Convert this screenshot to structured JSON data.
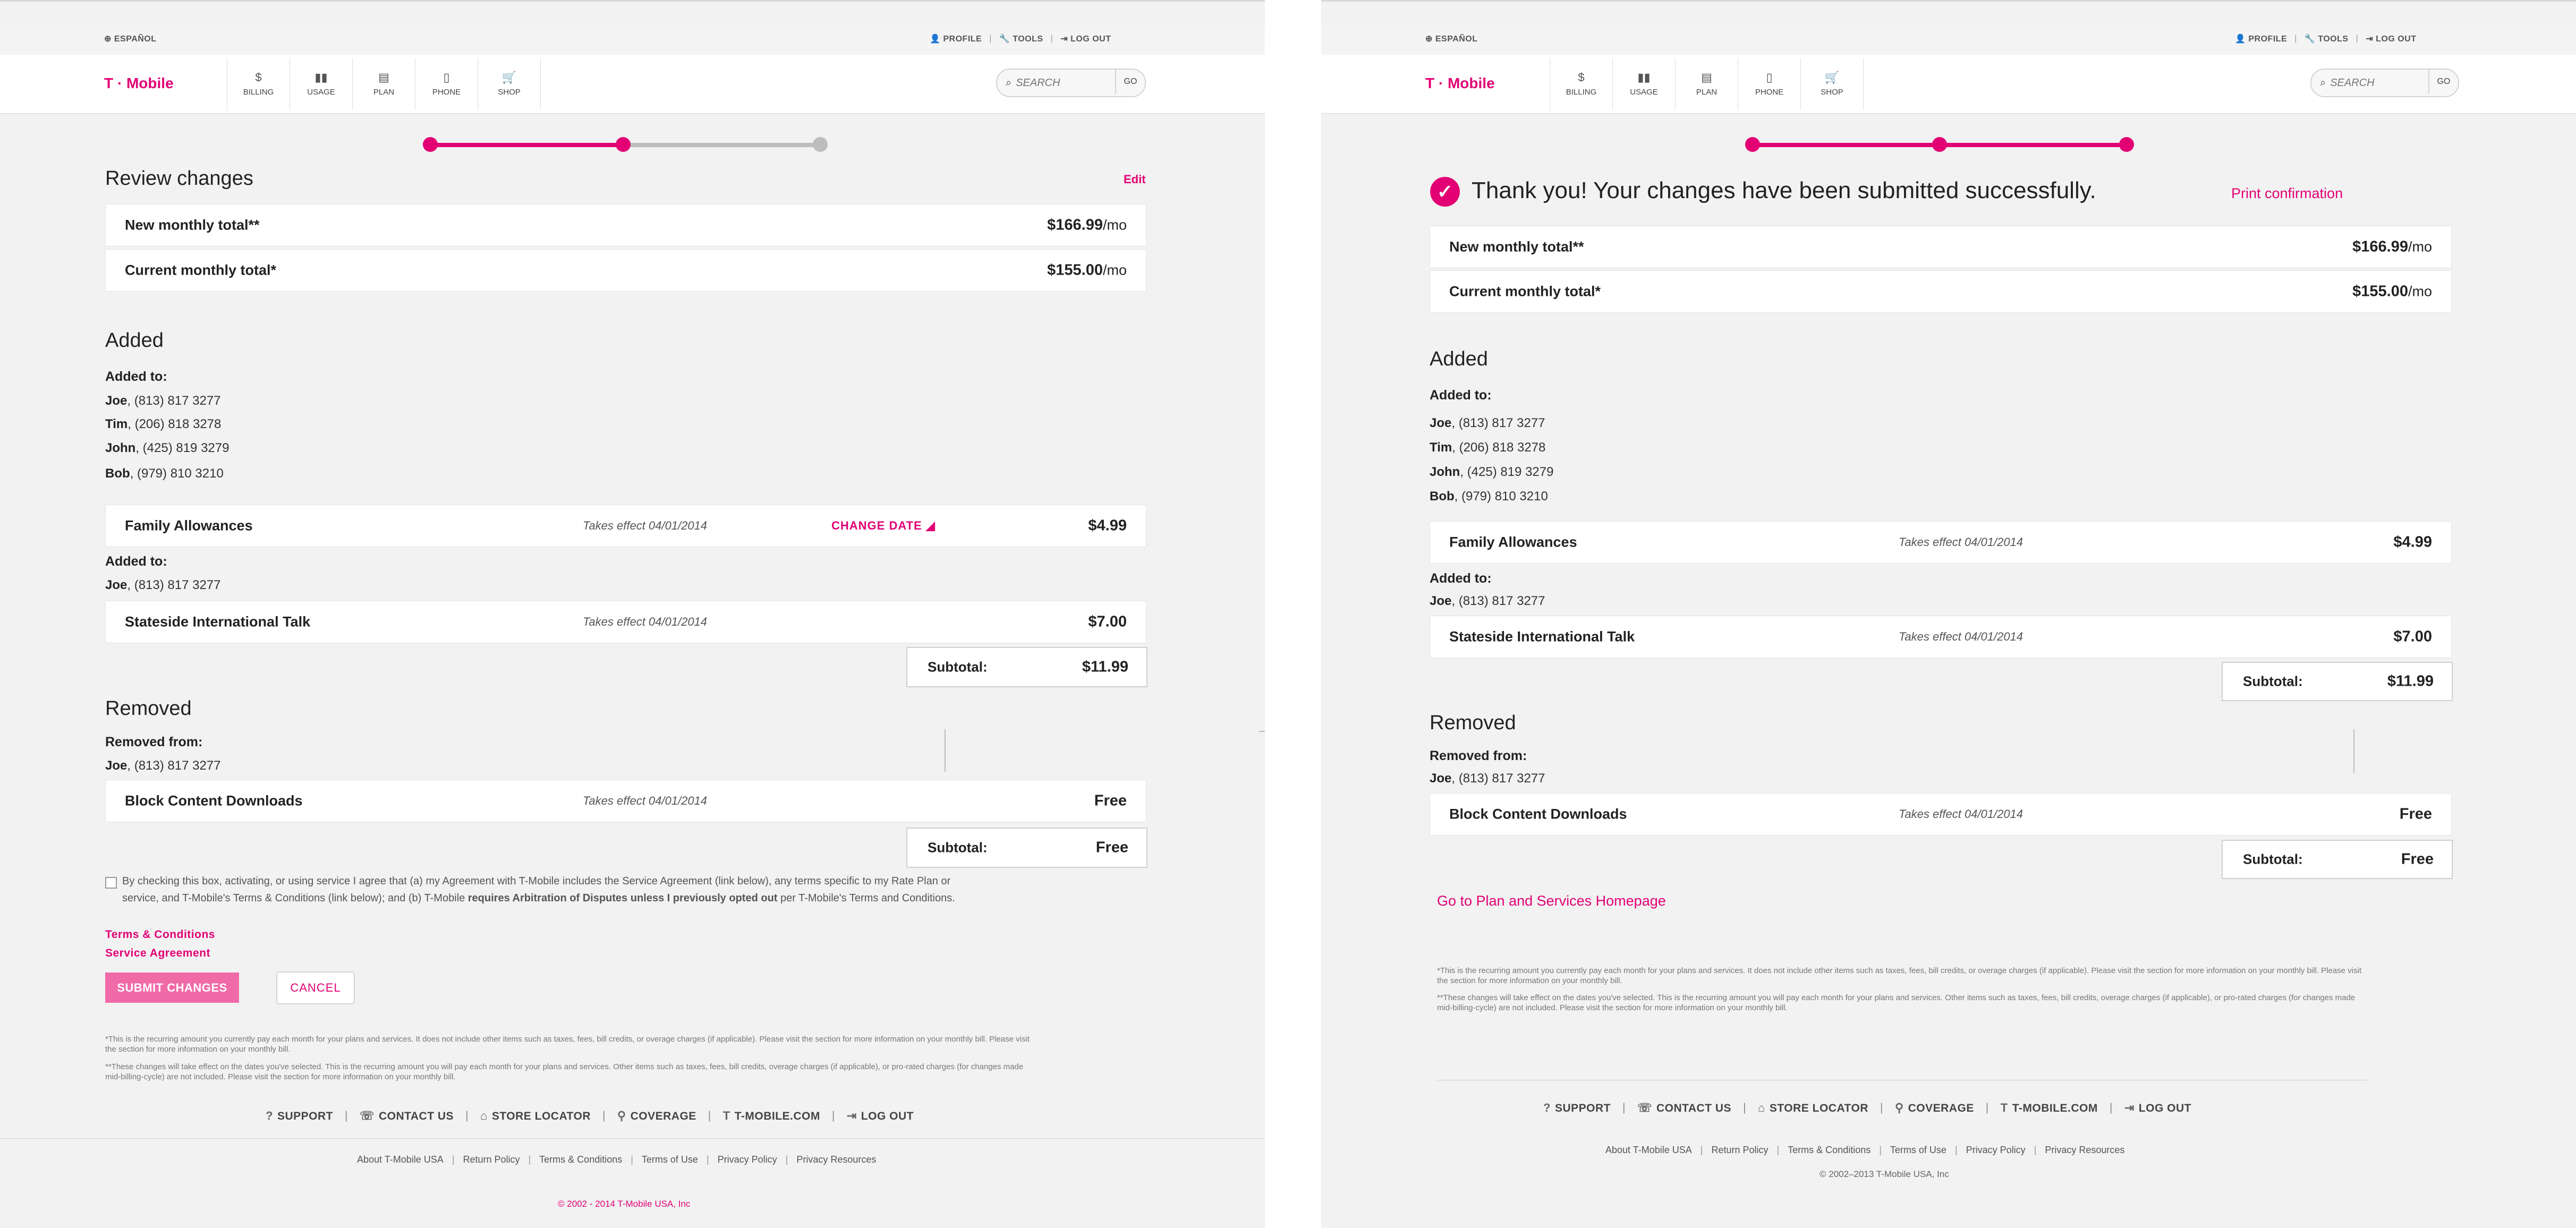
{
  "header": {
    "language": "ESPAÑOL",
    "profile": "PROFILE",
    "tools": "TOOLS",
    "logout": "LOG OUT",
    "logo": "T · Mobile",
    "nav": {
      "billing": "BILLING",
      "usage": "USAGE",
      "plan": "PLAN",
      "phone": "PHONE",
      "shop": "SHOP"
    },
    "search_placeholder": "SEARCH",
    "go": "GO"
  },
  "review": {
    "title": "Review changes",
    "edit": "Edit",
    "new_total_label": "New monthly total**",
    "new_total_value": "$166.99",
    "current_total_label": "Current monthly total*",
    "current_total_value": "$155.00",
    "per_month": "/mo",
    "added_title": "Added",
    "added_to": "Added to:",
    "lines": [
      {
        "name": "Joe",
        "number": ", (813) 817 3277"
      },
      {
        "name": "Tim",
        "number": ", (206) 818 3278"
      },
      {
        "name": "John",
        "number": ", (425) 819 3279"
      },
      {
        "name": "Bob",
        "number": ", (979) 810 3210"
      }
    ],
    "family_allowances": "Family Allowances",
    "takes_effect": "Takes effect 04/01/2014",
    "change_date": "CHANGE DATE",
    "family_price": "$4.99",
    "joe_line": {
      "name": "Joe",
      "number": ", (813) 817 3277"
    },
    "stateside": "Stateside International Talk",
    "stateside_price": "$7.00",
    "subtotal_label": "Subtotal:",
    "subtotal_added": "$11.99",
    "removed_title": "Removed",
    "removed_from": "Removed from:",
    "block_content": "Block Content Downloads",
    "free": "Free",
    "agreement_1": "By checking this box, activating, or using service I agree that (a) my Agreement with T-Mobile includes the Service Agreement (link below), any terms specific to my Rate Plan or",
    "agreement_2a": "service, and T-Mobile's Terms & Conditions (link below); and (b) T-Mobile ",
    "agreement_2b": "requires Arbitration of Disputes unless I previously opted out",
    "agreement_2c": " per T-Mobile's Terms and Conditions.",
    "terms_link": "Terms & Conditions",
    "service_link": "Service Agreement",
    "submit": "SUBMIT CHANGES",
    "cancel": "CANCEL"
  },
  "confirmation": {
    "thank_you": "Thank you! Your changes have been submitted successfully.",
    "print": "Print confirmation",
    "go_home": "Go to Plan and Services Homepage"
  },
  "footnotes": {
    "note1a": "*This is the recurring amount you currently pay each month for your plans and services. It does not include other items such as taxes, fees, bill credits, or overage charges (if applicable). Please visit the section for more information on your monthly bill. Please visit",
    "note1b": "the section for more information on your monthly bill.",
    "note2a": "**These changes will take effect on the dates you've selected. This is the recurring amount you will pay each month for your plans and services. Other items such as taxes, fees, bill credits, overage charges (if applicable), or pro-rated charges (for changes made",
    "note2b": "mid-billing-cycle) are not included. Please visit the section for more information on your monthly bill."
  },
  "footer": {
    "support": "SUPPORT",
    "contact": "CONTACT US",
    "store": "STORE LOCATOR",
    "coverage": "COVERAGE",
    "tmobile": "T-MOBILE.COM",
    "logout": "LOG OUT",
    "links": [
      "About T-Mobile USA",
      "Return Policy",
      "Terms & Conditions",
      "Terms of Use",
      "Privacy Policy",
      "Privacy Resources"
    ],
    "copyright_left": "© 2002 - 2014 T-Mobile USA, Inc",
    "copyright_right": "© 2002–2013 T-Mobile USA, Inc"
  },
  "colors": {
    "brand": "#e20074",
    "submit_bg": "#f06aa8"
  },
  "progress": {
    "left_step": "2 of 3",
    "right_step": "3 of 3"
  }
}
